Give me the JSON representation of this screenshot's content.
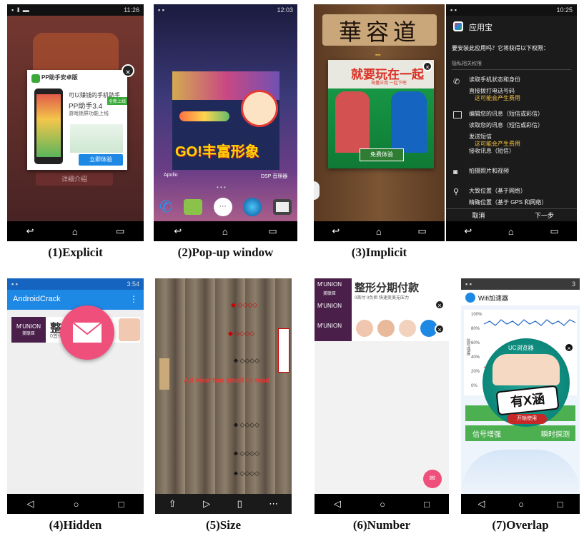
{
  "captions": [
    "(1)Explicit",
    "(2)Pop-up window",
    "(3)Implicit",
    "(4)Hidden",
    "(5)Size",
    "(6)Number",
    "(7)Overlap"
  ],
  "p1": {
    "time": "11:26",
    "popup_brand": "PP助手安卓版",
    "popup_line1": "可以赚钱的手机助手",
    "popup_line2": "PP助手3.4",
    "popup_badge": "全新上线",
    "popup_line3": "游戏锁屏功能上线",
    "popup_button": "立即体验",
    "bg_button": "详细介绍"
  },
  "p2": {
    "time": "12:03",
    "banner_text": "GO!丰富形象",
    "app_left": "Apollo",
    "app_right": "DSP 音理器"
  },
  "p3": {
    "board_title": "華容道",
    "ad_title": "就要玩在一起",
    "ad_sub": "海量应用 一起下吧",
    "ad_button": "免费体验",
    "time": "10:25",
    "store_name": "应用宝",
    "question": "要安装此应用吗？它将获得以下权限：",
    "section": "隐私相关权限",
    "perms": [
      {
        "icon": "phone-icon",
        "lines": [
          "读取手机状态和身份",
          "直接拨打电话号码"
        ],
        "warn": "这可能会产生费用"
      },
      {
        "icon": "message-icon",
        "lines": [
          "编辑您的讯息（短信或彩信）",
          "读取您的讯息（短信或彩信）",
          "发送短信"
        ],
        "warn": "这可能会产生费用",
        "after": "接收讯息（短信）"
      },
      {
        "icon": "camera-icon",
        "lines": [
          "拍摄照片和视频"
        ]
      },
      {
        "icon": "location-icon",
        "lines": [
          "大致位置（基于网络）",
          "精确位置（基于 GPS 和网络）"
        ]
      }
    ],
    "cancel": "取消",
    "next": "下一步"
  },
  "p4": {
    "time": "3:54",
    "app_title": "AndroidCrack",
    "ad_brand": "M'UNION",
    "ad_brand_cn": "美联臣",
    "ad_text": "整形",
    "ad_sub": "0首付"
  },
  "p5": {
    "overlay_text": "Ad view too small to read"
  },
  "p6": {
    "ad_brand": "M'UNION",
    "ad_brand_cn": "美联臣",
    "ad_title": "整形分期付款",
    "ad_sub": "0首付 0负担 快速变美无压力"
  },
  "p7": {
    "time": "3",
    "app_title": "Wifi加速器",
    "y_ticks": [
      "100%",
      "80%",
      "60%",
      "40%",
      "20%",
      "0%"
    ],
    "y_label": "信号强度",
    "ad_brand": "UC浏览器",
    "ad_badge": "有X涵",
    "ad_button": "开始使用",
    "btn1": "信号增强",
    "btn2": "瞬时探测"
  },
  "colors": {
    "pp_green": "#3aa93a",
    "tencent_blue": "#1e88e5",
    "ad_red": "#d93025",
    "fab_pink": "#ef4f7b",
    "wifi_green": "#4caf50"
  }
}
